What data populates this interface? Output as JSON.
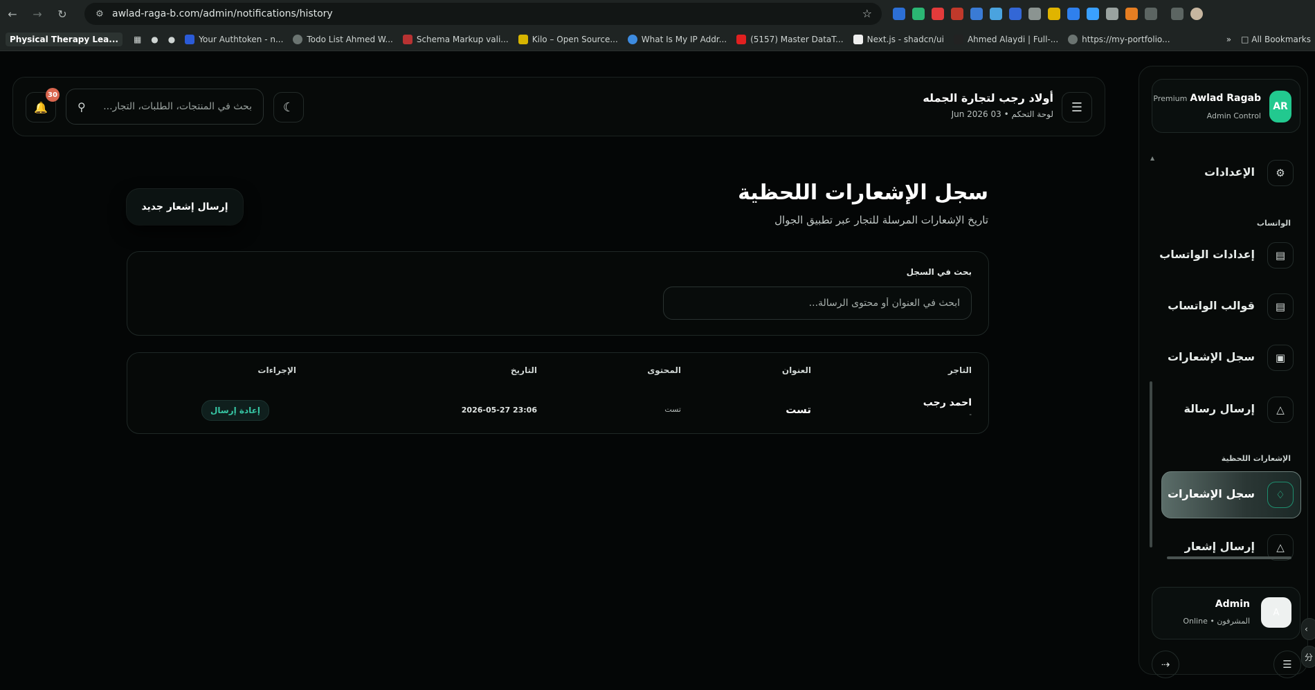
{
  "browser": {
    "url": "awlad-raga-b.com/admin/notifications/history",
    "bookmarks": [
      "Physical Therapy Lea...",
      "Your Authtoken - n...",
      "Todo List Ahmed W...",
      "Schema Markup vali...",
      "Kilo – Open Source...",
      "What Is My IP Addr...",
      "(5157) Master DataT...",
      "Next.js - shadcn/ui",
      "Ahmed Alaydi | Full-...",
      "https://my-portfolio..."
    ],
    "all_bookmarks": "All Bookmarks"
  },
  "header": {
    "title": "أولاد رجب لتجارة الجمله",
    "subtitle": "لوحة التحكم • 03 Jun 2026",
    "search_placeholder": "بحث في المنتجات، الطلبات، التجار...",
    "notification_count": "30"
  },
  "page": {
    "title": "سجل الإشعارات اللحظية",
    "subtitle": "تاريخ الإشعارات المرسلة للتجار عبر تطبيق الجوال",
    "send_button": "إرسال إشعار جديد"
  },
  "filter": {
    "label": "بحث في السجل",
    "placeholder": "ابحث في العنوان أو محتوى الرسالة..."
  },
  "table": {
    "headers": {
      "merchant": "التاجر",
      "title": "العنوان",
      "content": "المحتوى",
      "date": "التاريخ",
      "actions": "الإجراءات"
    },
    "rows": [
      {
        "merchant": "احمد رجب",
        "merchant_sub": "-",
        "title": "تست",
        "content": "تست",
        "date": "2026-05-27 23:06",
        "action": "إعادة إرسال"
      }
    ]
  },
  "sidebar": {
    "brand_name": "Awlad Ragab",
    "brand_tier": "Premium",
    "brand_role": "Admin Control",
    "brand_initials": "AR",
    "items": [
      {
        "label": "الإعدادات",
        "icon": "gear-icon"
      },
      {
        "label": "إعدادات الواتساب",
        "icon": "chat-icon"
      },
      {
        "label": "قوالب الواتساب",
        "icon": "document-icon"
      },
      {
        "label": "سجل الإشعارات",
        "icon": "clipboard-icon"
      },
      {
        "label": "إرسال رسالة",
        "icon": "send-icon"
      },
      {
        "label": "سجل الإشعارات",
        "icon": "bell-icon"
      },
      {
        "label": "إرسال إشعار",
        "icon": "send-icon"
      }
    ],
    "sections": {
      "whatsapp": "الواتساب",
      "realtime": "الإشعارات اللحظية"
    },
    "admin_name": "Admin",
    "admin_status": "المشرفون • Online",
    "admin_initial": "A"
  },
  "colors": {
    "accent": "#22c98f",
    "badge": "#d9664f",
    "resend": "#37c7a5"
  }
}
